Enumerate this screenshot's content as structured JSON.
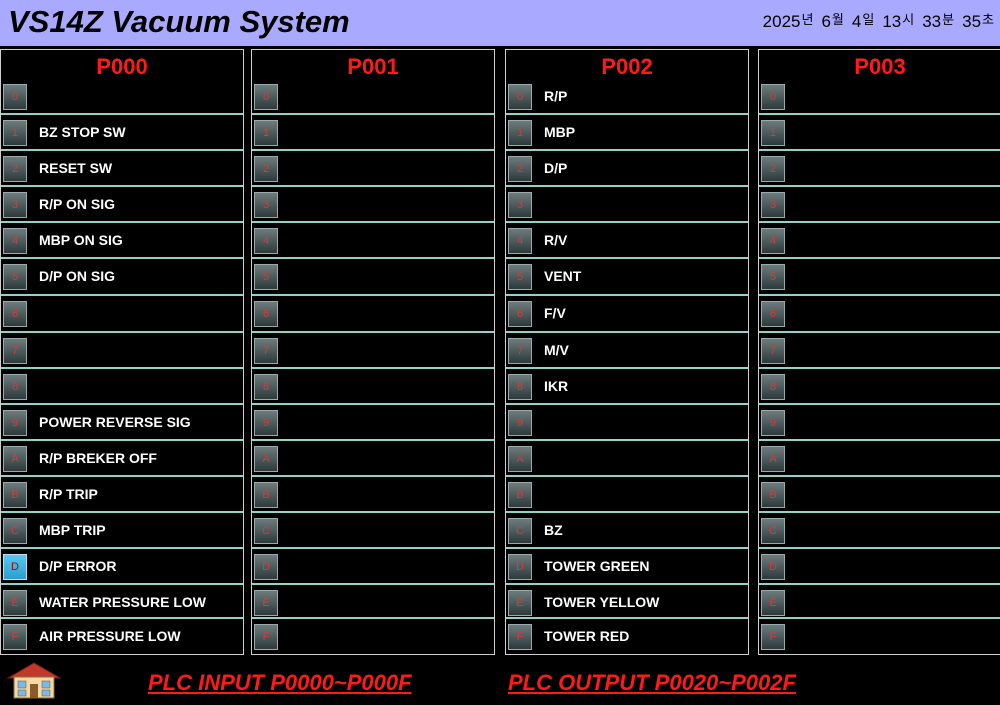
{
  "header": {
    "title": "VS14Z Vacuum System",
    "clock": {
      "year": "2025",
      "year_unit": "년",
      "month": "6",
      "month_unit": "월",
      "day": "4",
      "day_unit": "일",
      "hour": "13",
      "hour_unit": "시",
      "minute": "33",
      "minute_unit": "분",
      "second": "35",
      "second_unit": "초"
    }
  },
  "panels": [
    {
      "title": "P000",
      "rows": [
        {
          "bit": "0",
          "label": "",
          "on": false
        },
        {
          "bit": "1",
          "label": "BZ STOP SW",
          "on": false
        },
        {
          "bit": "2",
          "label": "RESET SW",
          "on": false
        },
        {
          "bit": "3",
          "label": "R/P ON SIG",
          "on": false
        },
        {
          "bit": "4",
          "label": "MBP ON SIG",
          "on": false
        },
        {
          "bit": "5",
          "label": "D/P ON SIG",
          "on": false
        },
        {
          "bit": "6",
          "label": "",
          "on": false
        },
        {
          "bit": "7",
          "label": "",
          "on": false
        },
        {
          "bit": "8",
          "label": "",
          "on": false
        },
        {
          "bit": "9",
          "label": "POWER REVERSE SIG",
          "on": false
        },
        {
          "bit": "A",
          "label": "R/P BREKER OFF",
          "on": false
        },
        {
          "bit": "B",
          "label": "R/P TRIP",
          "on": false
        },
        {
          "bit": "C",
          "label": "MBP TRIP",
          "on": false
        },
        {
          "bit": "D",
          "label": "D/P ERROR",
          "on": true
        },
        {
          "bit": "E",
          "label": "WATER PRESSURE LOW",
          "on": false
        },
        {
          "bit": "F",
          "label": "AIR PRESSURE LOW",
          "on": false
        }
      ]
    },
    {
      "title": "P001",
      "rows": [
        {
          "bit": "0",
          "label": "",
          "on": false
        },
        {
          "bit": "1",
          "label": "",
          "on": false
        },
        {
          "bit": "2",
          "label": "",
          "on": false
        },
        {
          "bit": "3",
          "label": "",
          "on": false
        },
        {
          "bit": "4",
          "label": "",
          "on": false
        },
        {
          "bit": "5",
          "label": "",
          "on": false
        },
        {
          "bit": "6",
          "label": "",
          "on": false
        },
        {
          "bit": "7",
          "label": "",
          "on": false
        },
        {
          "bit": "8",
          "label": "",
          "on": false
        },
        {
          "bit": "9",
          "label": "",
          "on": false
        },
        {
          "bit": "A",
          "label": "",
          "on": false
        },
        {
          "bit": "B",
          "label": "",
          "on": false
        },
        {
          "bit": "C",
          "label": "",
          "on": false
        },
        {
          "bit": "D",
          "label": "",
          "on": false
        },
        {
          "bit": "E",
          "label": "",
          "on": false
        },
        {
          "bit": "F",
          "label": "",
          "on": false
        }
      ]
    },
    {
      "title": "P002",
      "rows": [
        {
          "bit": "0",
          "label": "R/P",
          "on": false
        },
        {
          "bit": "1",
          "label": "MBP",
          "on": false
        },
        {
          "bit": "2",
          "label": "D/P",
          "on": false
        },
        {
          "bit": "3",
          "label": "",
          "on": false
        },
        {
          "bit": "4",
          "label": "R/V",
          "on": false
        },
        {
          "bit": "5",
          "label": "VENT",
          "on": false
        },
        {
          "bit": "6",
          "label": "F/V",
          "on": false
        },
        {
          "bit": "7",
          "label": "M/V",
          "on": false
        },
        {
          "bit": "8",
          "label": "IKR",
          "on": false
        },
        {
          "bit": "9",
          "label": "",
          "on": false
        },
        {
          "bit": "A",
          "label": "",
          "on": false
        },
        {
          "bit": "B",
          "label": "",
          "on": false
        },
        {
          "bit": "C",
          "label": "BZ",
          "on": false
        },
        {
          "bit": "D",
          "label": "TOWER GREEN",
          "on": false
        },
        {
          "bit": "E",
          "label": "TOWER YELLOW",
          "on": false
        },
        {
          "bit": "F",
          "label": "TOWER RED",
          "on": false
        }
      ]
    },
    {
      "title": "P003",
      "rows": [
        {
          "bit": "0",
          "label": "",
          "on": false
        },
        {
          "bit": "1",
          "label": "",
          "on": false
        },
        {
          "bit": "2",
          "label": "",
          "on": false
        },
        {
          "bit": "3",
          "label": "",
          "on": false
        },
        {
          "bit": "4",
          "label": "",
          "on": false
        },
        {
          "bit": "5",
          "label": "",
          "on": false
        },
        {
          "bit": "6",
          "label": "",
          "on": false
        },
        {
          "bit": "7",
          "label": "",
          "on": false
        },
        {
          "bit": "8",
          "label": "",
          "on": false
        },
        {
          "bit": "9",
          "label": "",
          "on": false
        },
        {
          "bit": "A",
          "label": "",
          "on": false
        },
        {
          "bit": "B",
          "label": "",
          "on": false
        },
        {
          "bit": "C",
          "label": "",
          "on": false
        },
        {
          "bit": "D",
          "label": "",
          "on": false
        },
        {
          "bit": "E",
          "label": "",
          "on": false
        },
        {
          "bit": "F",
          "label": "",
          "on": false
        }
      ]
    }
  ],
  "footer": {
    "home_icon": "home-icon",
    "input_text": "PLC INPUT  P0000~P000F",
    "output_text": "PLC OUTPUT  P0020~P002F"
  },
  "colors": {
    "header_bg": "#a9a9ff",
    "panel_title": "#ff1a1a",
    "row_divider": "#8fd3c9",
    "bit_on": "#57c8f0"
  }
}
